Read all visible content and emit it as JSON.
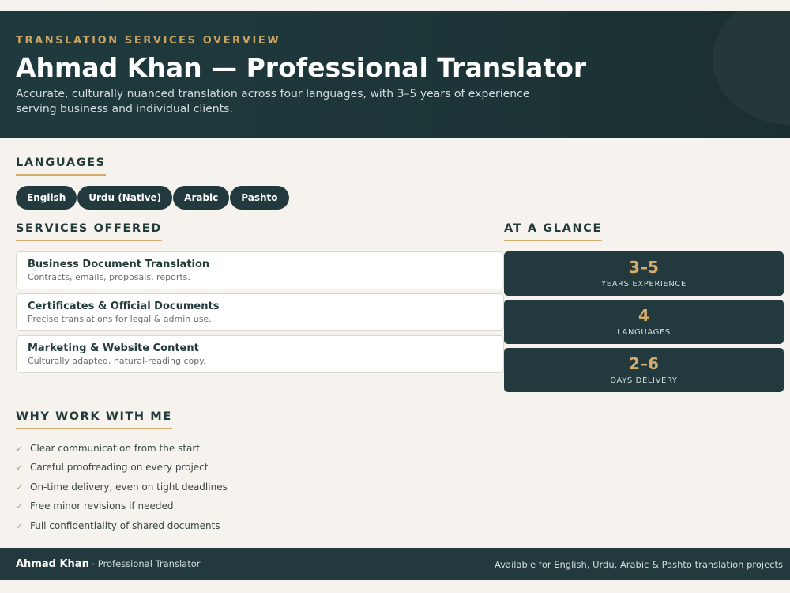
{
  "header": {
    "kicker": "TRANSLATION SERVICES OVERVIEW",
    "title": "Ahmad Khan — Professional Translator",
    "subtitle": "Accurate, culturally nuanced translation across four languages, with 3–5 years of experience serving business and individual clients."
  },
  "languages": {
    "heading": "LANGUAGES",
    "items": [
      "English",
      "Urdu (Native)",
      "Arabic",
      "Pashto"
    ]
  },
  "services": {
    "heading": "SERVICES OFFERED",
    "items": [
      {
        "title": "Business Document Translation",
        "desc": "Contracts, emails, proposals, reports."
      },
      {
        "title": "Certificates & Official Documents",
        "desc": "Precise translations for legal & admin use."
      },
      {
        "title": "Marketing & Website Content",
        "desc": "Culturally adapted, natural-reading copy."
      }
    ]
  },
  "glance": {
    "heading": "AT A GLANCE",
    "stats": [
      {
        "value": "3–5",
        "label": "YEARS EXPERIENCE"
      },
      {
        "value": "4",
        "label": "LANGUAGES"
      },
      {
        "value": "2–6",
        "label": "DAYS DELIVERY"
      }
    ]
  },
  "why": {
    "heading": "WHY WORK WITH ME",
    "check_icon": "✓",
    "items": [
      "Clear communication from the start",
      "Careful proofreading on every project",
      "On-time delivery, even on tight deadlines",
      "Free minor revisions if needed",
      "Full confidentiality of shared documents"
    ]
  },
  "footer": {
    "name": "Ahmad Khan",
    "separator": "·",
    "role": "Professional Translator",
    "availability": "Available for English, Urdu, Arabic & Pashto translation projects"
  },
  "colors": {
    "primary": "#223a3d",
    "accent": "#d4ac6e",
    "background": "#f6f3ee",
    "check": "#8fae7a"
  }
}
